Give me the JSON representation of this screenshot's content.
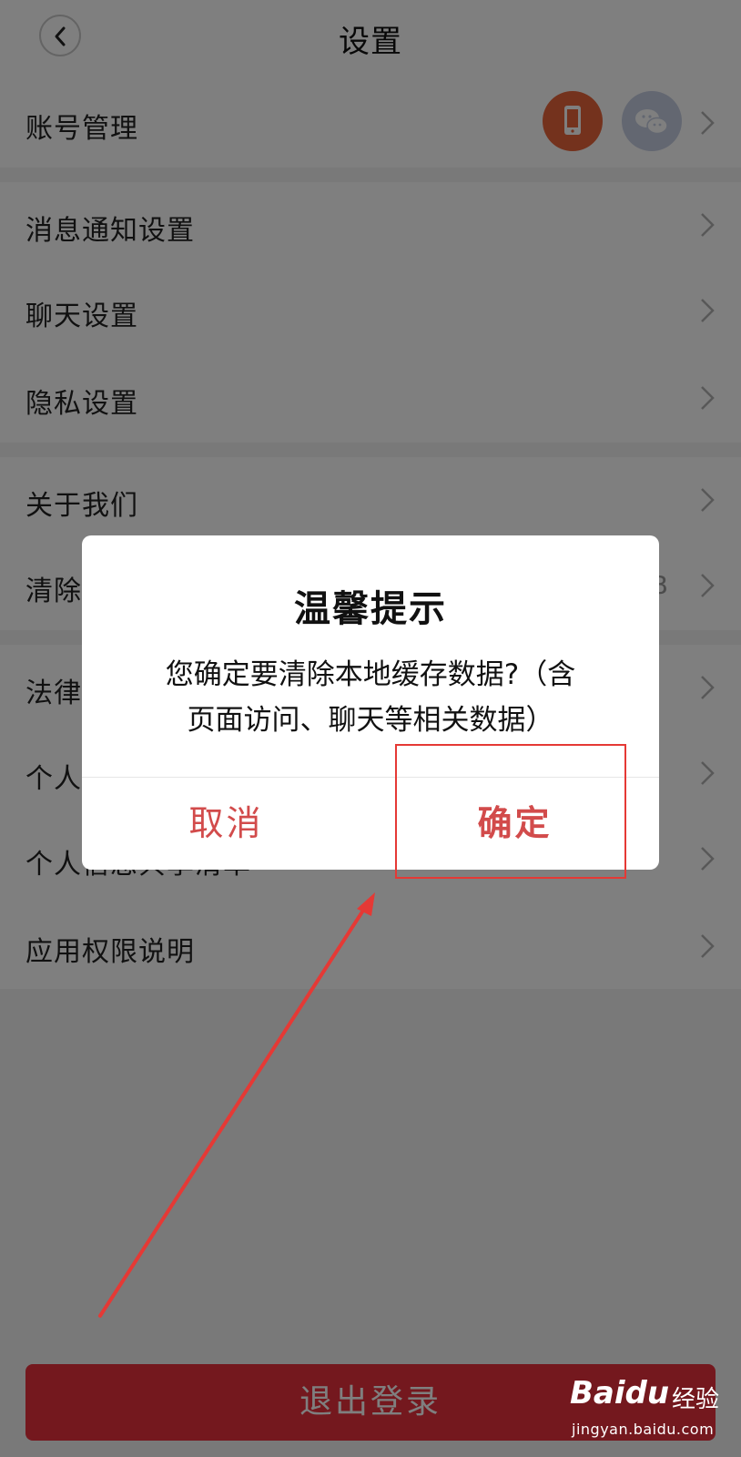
{
  "header": {
    "title": "设置"
  },
  "list": {
    "account": {
      "label": "账号管理"
    },
    "notifications": {
      "label": "消息通知设置"
    },
    "chat": {
      "label": "聊天设置"
    },
    "privacy": {
      "label": "隐私设置"
    },
    "about": {
      "label": "关于我们"
    },
    "clear_cache": {
      "label": "清除",
      "size": "KB"
    },
    "legal": {
      "label": "法律"
    },
    "personal": {
      "label": "个人"
    },
    "share_list": {
      "label": "个人信息共享清单"
    },
    "permissions": {
      "label": "应用权限说明"
    }
  },
  "logout": {
    "label": "退出登录"
  },
  "dialog": {
    "title": "温馨提示",
    "message_line1": "您确定要清除本地缓存数据?（含",
    "message_line2": "页面访问、聊天等相关数据）",
    "cancel_label": "取消",
    "confirm_label": "确定"
  },
  "watermark": {
    "brand": "Baidu",
    "product": "经验",
    "url": "jingyan.baidu.com"
  },
  "colors": {
    "accent": "#d24b4b",
    "logout": "#e8303d",
    "annotation": "#e53935"
  }
}
